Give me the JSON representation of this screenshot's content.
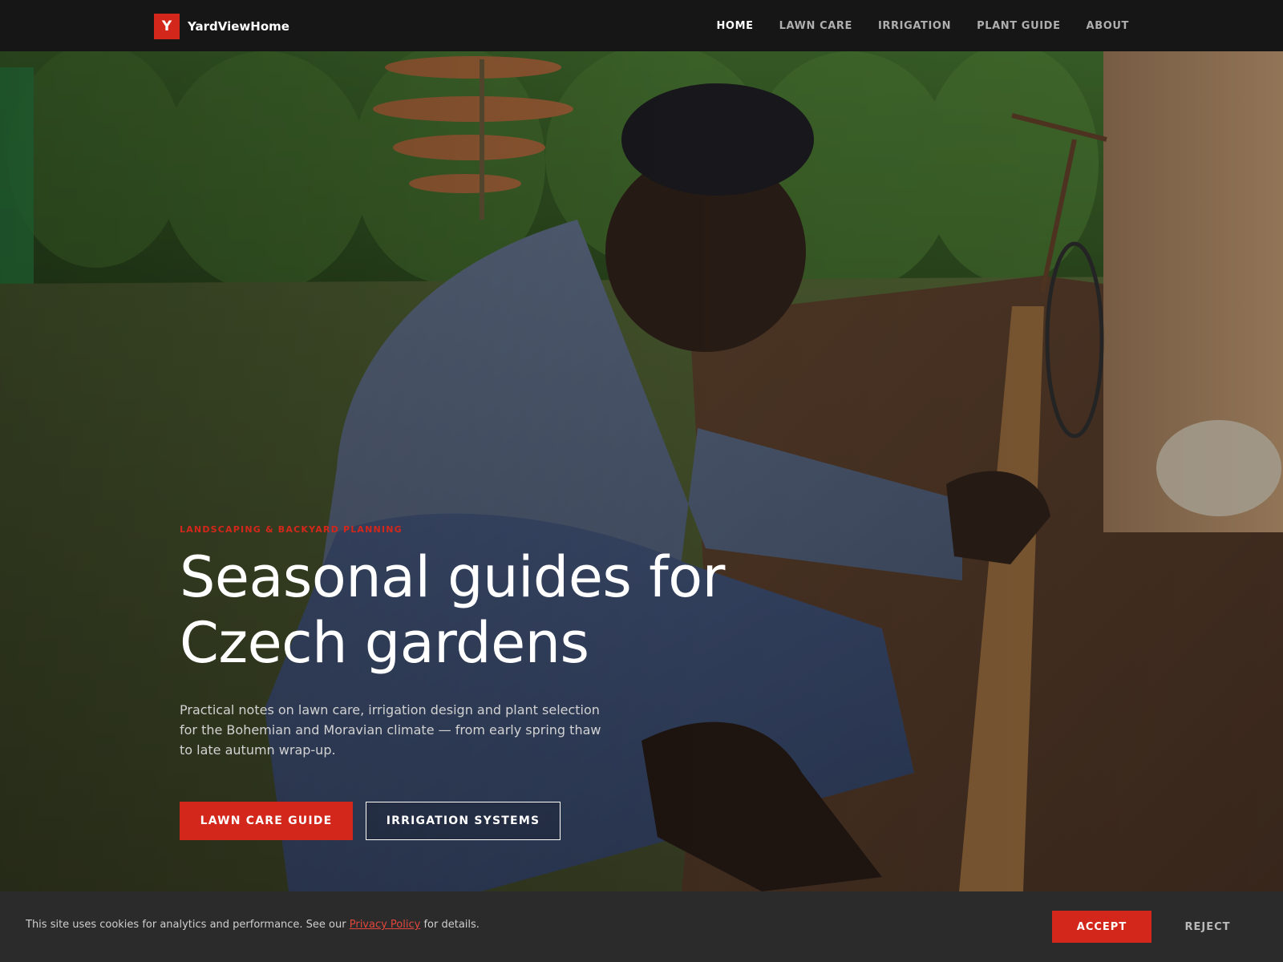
{
  "brand": {
    "logo_letter": "Y",
    "name": "YardViewHome",
    "accent_color": "#d3271b"
  },
  "nav": {
    "items": [
      {
        "label": "HOME",
        "active": true
      },
      {
        "label": "LAWN CARE",
        "active": false
      },
      {
        "label": "IRRIGATION",
        "active": false
      },
      {
        "label": "PLANT GUIDE",
        "active": false
      },
      {
        "label": "ABOUT",
        "active": false
      }
    ]
  },
  "hero": {
    "eyebrow": "LANDSCAPING & BACKYARD PLANNING",
    "headline_line1": "Seasonal guides for",
    "headline_line2": "Czech gardens",
    "lede": "Practical notes on lawn care, irrigation design and plant selection for the Bohemian and Moravian climate — from early spring thaw to late autumn wrap-up.",
    "primary_cta": "LAWN CARE GUIDE",
    "secondary_cta": "IRRIGATION SYSTEMS"
  },
  "cookie_banner": {
    "text_before": "This site uses cookies for analytics and performance. See our ",
    "link_text": "Privacy Policy",
    "text_after": " for details.",
    "accept": "ACCEPT",
    "reject": "REJECT"
  }
}
